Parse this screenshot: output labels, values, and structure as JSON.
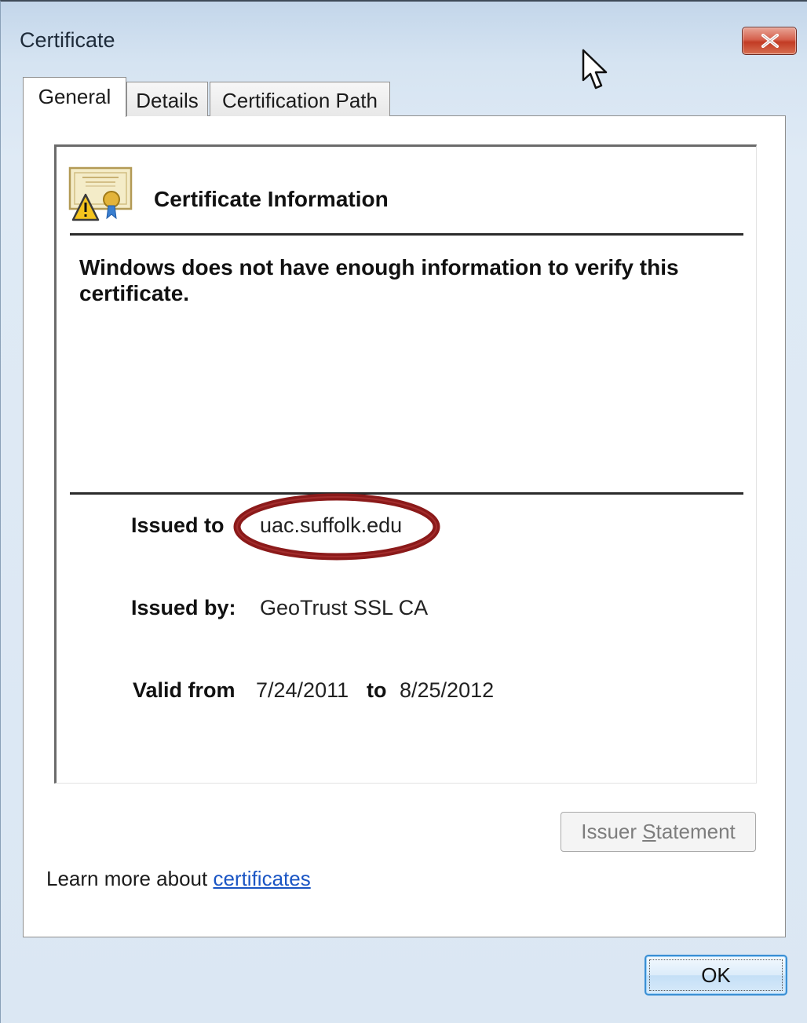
{
  "window": {
    "title": "Certificate",
    "close_icon": "close-icon"
  },
  "tabs": [
    {
      "label": "General",
      "active": true
    },
    {
      "label": "Details",
      "active": false
    },
    {
      "label": "Certification Path",
      "active": false
    }
  ],
  "general": {
    "heading": "Certificate Information",
    "warning": "Windows does not have enough information to verify this certificate.",
    "issued_to_label": "Issued to",
    "issued_to_value": "uac.suffolk.edu",
    "issued_by_label": "Issued by:",
    "issued_by_value": "GeoTrust SSL CA",
    "valid_from_label": "Valid from",
    "valid_from_value": "7/24/2011",
    "valid_to_label": "to",
    "valid_to_value": "8/25/2012"
  },
  "buttons": {
    "issuer_statement_pre": "Issuer ",
    "issuer_statement_key": "S",
    "issuer_statement_post": "tatement",
    "ok": "OK"
  },
  "footer": {
    "learn_more": "Learn more about ",
    "link": "certificates"
  },
  "colors": {
    "highlight_ellipse": "#8b1a1a",
    "link": "#1a55c4",
    "close_button": "#c23b24"
  }
}
